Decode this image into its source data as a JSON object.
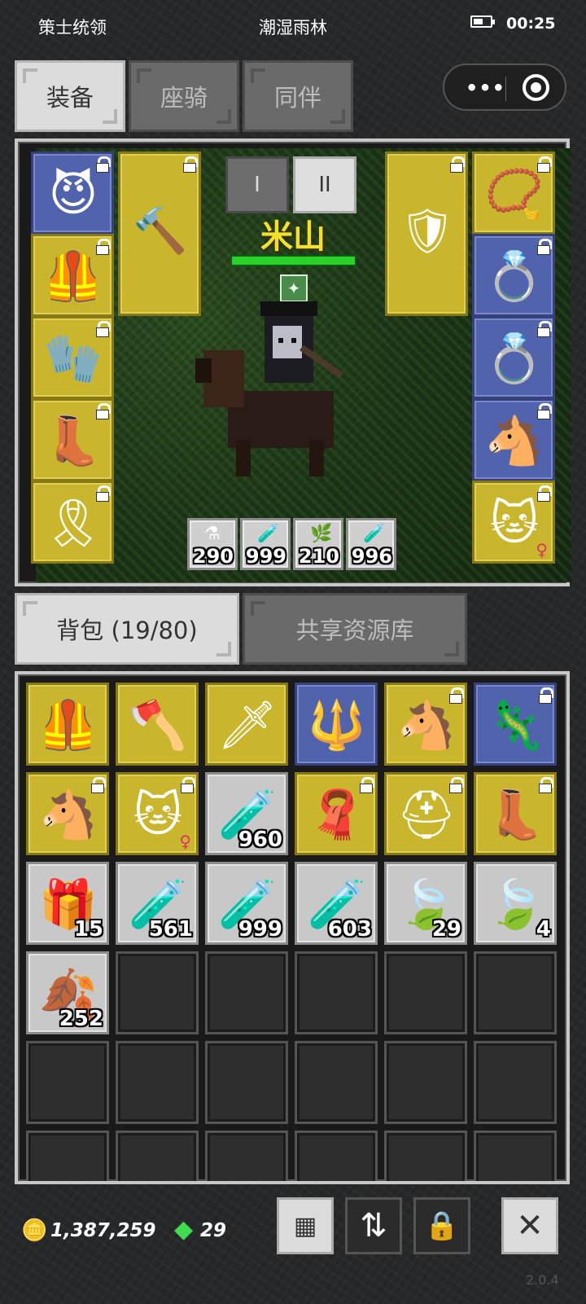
{
  "status_bar": {
    "left": "策士统领",
    "title": "潮湿雨林",
    "time": "00:25"
  },
  "top_tabs": [
    {
      "label": "装备"
    },
    {
      "label": "座骑"
    },
    {
      "label": "同伴"
    }
  ],
  "capsule": {
    "more": "•••"
  },
  "hero": {
    "name": "米山",
    "hp_fraction": 1.0,
    "buff_icon": "buff-icon",
    "page_buttons": [
      {
        "label": "I"
      },
      {
        "label": "II"
      }
    ]
  },
  "equip_left": [
    {
      "icon": "horned-helmet-icon",
      "glyph": "😈",
      "color": "blue"
    },
    {
      "icon": "chainmail-armor-icon",
      "glyph": "🦺",
      "color": "yellow"
    },
    {
      "icon": "gauntlet-icon",
      "glyph": "🧤",
      "color": "yellow"
    },
    {
      "icon": "boots-icon",
      "glyph": "👢",
      "color": "yellow"
    },
    {
      "icon": "belt-icon",
      "glyph": "🎗",
      "color": "yellow"
    }
  ],
  "equip_right": [
    {
      "icon": "amulet-icon",
      "glyph": "📿",
      "color": "yellow"
    },
    {
      "icon": "ruby-ring-icon",
      "glyph": "💍",
      "color": "blue"
    },
    {
      "icon": "sapphire-ring-icon",
      "glyph": "💍",
      "color": "blue"
    },
    {
      "icon": "horse-mount-icon",
      "glyph": "🐴",
      "color": "blue"
    },
    {
      "icon": "cat-pet-icon",
      "glyph": "🐱",
      "color": "yellow",
      "gender": "♀"
    }
  ],
  "weapon_slot": {
    "icon": "mace-wand-icon",
    "glyph": "🔨"
  },
  "shield_slot": {
    "icon": "shield-icon",
    "glyph": "🛡"
  },
  "quick_slots": [
    {
      "icon": "potion-pair-icon",
      "glyph": "⚗",
      "count": "290"
    },
    {
      "icon": "potion-icon",
      "glyph": "🧪",
      "count": "999"
    },
    {
      "icon": "herb-icon",
      "glyph": "🌿",
      "count": "210"
    },
    {
      "icon": "potion-icon",
      "glyph": "🧪",
      "count": "996"
    }
  ],
  "bag_tabs": [
    {
      "label": "背包 (19/80)"
    },
    {
      "label": "共享资源库"
    }
  ],
  "bag": [
    {
      "icon": "dark-armor-icon",
      "glyph": "🦺",
      "color": "yellow",
      "lock": false
    },
    {
      "icon": "battle-axe-icon",
      "glyph": "🪓",
      "color": "yellow",
      "lock": false
    },
    {
      "icon": "scimitar-icon",
      "glyph": "🗡",
      "color": "yellow",
      "lock": false
    },
    {
      "icon": "spear-icon",
      "glyph": "🔱",
      "color": "blue",
      "lock": false
    },
    {
      "icon": "horse-mount-icon",
      "glyph": "🐴",
      "color": "yellow",
      "lock": true
    },
    {
      "icon": "lizard-mount-icon",
      "glyph": "🦎",
      "color": "blue",
      "lock": true
    },
    {
      "icon": "horse-mount-icon",
      "glyph": "🐴",
      "color": "yellow",
      "lock": true
    },
    {
      "icon": "cat-pet-icon",
      "glyph": "🐱",
      "color": "yellow",
      "lock": true,
      "gender": "♀"
    },
    {
      "icon": "red-potion-icon",
      "glyph": "🧪",
      "color": "gray",
      "count": "960"
    },
    {
      "icon": "red-cape-icon",
      "glyph": "🧣",
      "color": "yellow",
      "lock": true
    },
    {
      "icon": "golden-helmet-icon",
      "glyph": "⛑",
      "color": "yellow",
      "lock": true
    },
    {
      "icon": "boots-icon",
      "glyph": "👢",
      "color": "yellow",
      "lock": true
    },
    {
      "icon": "gift-bag-icon",
      "glyph": "🎁",
      "color": "gray",
      "count": "15"
    },
    {
      "icon": "blue-vial-icon",
      "glyph": "🧪",
      "color": "gray",
      "count": "561"
    },
    {
      "icon": "red-vial-icon",
      "glyph": "🧪",
      "color": "gray",
      "count": "999"
    },
    {
      "icon": "red-vial-icon",
      "glyph": "🧪",
      "color": "gray",
      "count": "603"
    },
    {
      "icon": "green-leaf-icon",
      "glyph": "🍃",
      "color": "gray",
      "count": "29"
    },
    {
      "icon": "blue-leaf-icon",
      "glyph": "🍃",
      "color": "gray",
      "count": "4"
    },
    {
      "icon": "red-leaf-icon",
      "glyph": "🍂",
      "color": "gray",
      "count": "252"
    }
  ],
  "footer": {
    "gold": "1,387,259",
    "gems": "29",
    "version": "2.0.4"
  }
}
